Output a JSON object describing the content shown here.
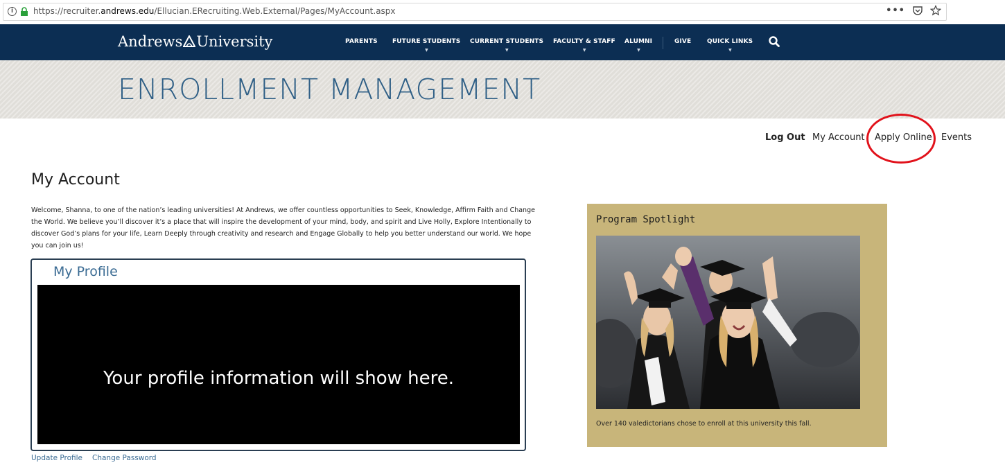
{
  "browser": {
    "url_prefix": "https://recruiter.",
    "url_domain": "andrews.edu",
    "url_path": "/Ellucian.ERecruiting.Web.External/Pages/MyAccount.aspx",
    "more_label": "•••"
  },
  "site": {
    "logo_left": "Andrews",
    "logo_right": "University",
    "nav": [
      "PARENTS",
      "FUTURE STUDENTS",
      "CURRENT STUDENTS",
      "FACULTY & STAFF",
      "ALUMNI",
      "GIVE",
      "QUICK LINKS"
    ],
    "nav_color": "#0c2e53"
  },
  "banner": {
    "title": "ENROLLMENT MANAGEMENT"
  },
  "usernav": {
    "logout": "Log Out",
    "my_account": "My Account",
    "apply_online": "Apply Online",
    "events": "Events",
    "highlight_color": "#e1121b"
  },
  "main": {
    "title": "My Account",
    "welcome": "Welcome, Shanna, to one of the nation’s leading universities! At Andrews, we offer countless opportunities to Seek, Knowledge, Affirm Faith and Change the World. We believe you’ll discover it’s a place that will inspire the development of your mind, body, and spirit and Live Holly, Explore Intentionally to discover God’s plans for your life, Learn Deeply through creativity and research and Engage Globally to help you better understand our world. We hope you can join us!",
    "profile": {
      "title": "My Profile",
      "placeholder": "Your profile information will show here."
    },
    "links": {
      "update_profile": "Update Profile",
      "change_password": "Change Password"
    }
  },
  "spotlight": {
    "title": "Program Spotlight",
    "caption": "Over 140 valedictorians chose to enroll at this university this fall.",
    "background": "#c8b57a"
  }
}
